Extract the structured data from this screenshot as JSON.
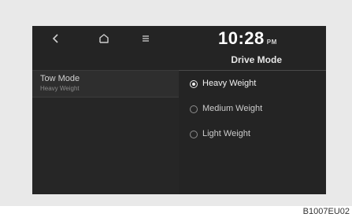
{
  "clock": {
    "time": "10:28",
    "ampm": "PM"
  },
  "header": {
    "title": "Drive Mode"
  },
  "left_menu": {
    "items": [
      {
        "label": "Tow Mode",
        "sub": "Heavy Weight"
      }
    ]
  },
  "options": [
    {
      "label": "Heavy Weight",
      "selected": true
    },
    {
      "label": "Medium Weight",
      "selected": false
    },
    {
      "label": "Light Weight",
      "selected": false
    }
  ],
  "icons": {
    "back": "chevron-left-icon",
    "home": "home-icon",
    "menu": "menu-icon"
  },
  "colors": {
    "screen_bg": "#242424",
    "frame_bg": "#e9e9e9"
  },
  "caption": "B1007EU02"
}
